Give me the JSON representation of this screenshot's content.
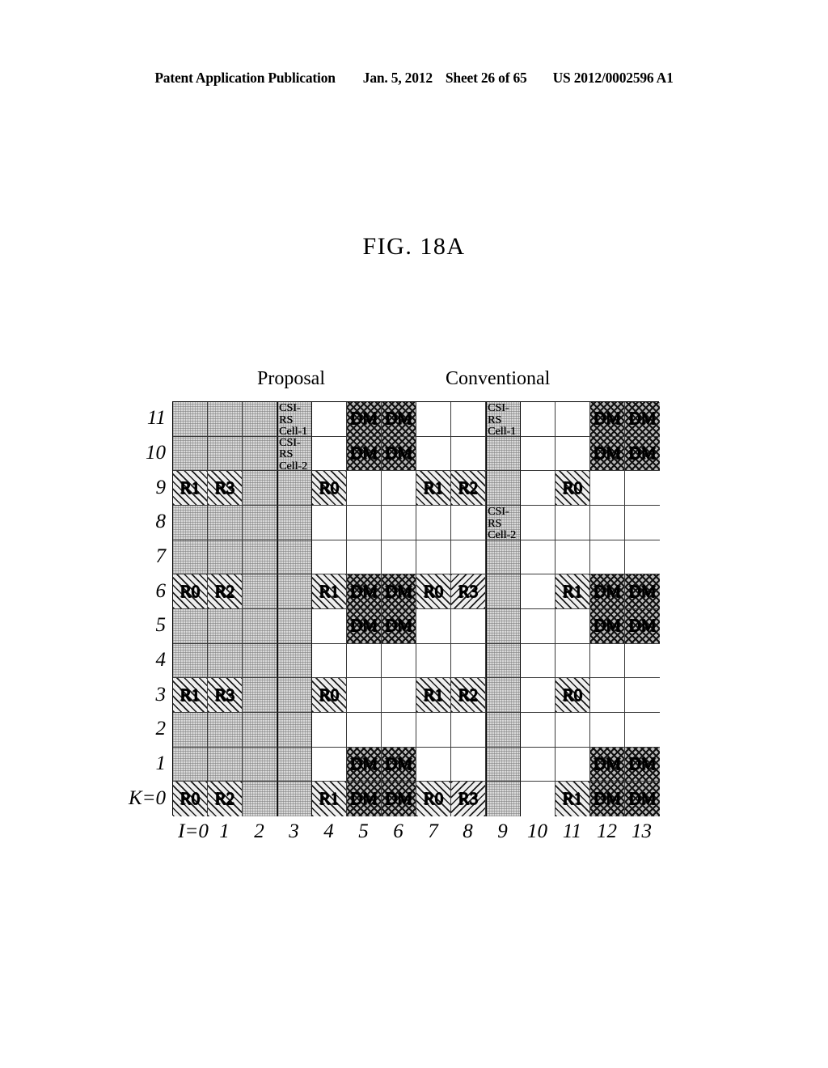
{
  "header": {
    "publication": "Patent Application Publication",
    "date": "Jan. 5, 2012",
    "sheet": "Sheet 26 of 65",
    "number": "US 2012/0002596 A1"
  },
  "figure": {
    "title": "FIG. 18A",
    "captions": {
      "left": "Proposal",
      "right": "Conventional"
    },
    "y_axis_labels": [
      "11",
      "10",
      "9",
      "8",
      "7",
      "6",
      "5",
      "4",
      "3",
      "2",
      "1",
      "K=0"
    ],
    "x_axis_labels": [
      "I=0",
      "1",
      "2",
      "3",
      "4",
      "5",
      "6",
      "7",
      "8",
      "9",
      "10",
      "11",
      "12",
      "13"
    ]
  },
  "chart_data": {
    "type": "heatmap",
    "title": "FIG. 18A",
    "xlabel": "I",
    "ylabel": "K",
    "x": [
      0,
      1,
      2,
      3,
      4,
      5,
      6,
      7,
      8,
      9,
      10,
      11,
      12,
      13
    ],
    "y": [
      11,
      10,
      9,
      8,
      7,
      6,
      5,
      4,
      3,
      2,
      1,
      0
    ],
    "legend": [
      "Proposal",
      "Conventional"
    ],
    "fill_types": {
      "white": "empty resource element",
      "gray": "light stipple shaded (reserved) column",
      "hatch": "forward diagonal hatch (CRS R-port)",
      "hatch-b": "back diagonal hatch (CRS R-port)",
      "cross": "dark cross hatch (DM-RS)"
    },
    "rows": [
      {
        "k": "11",
        "cells": [
          {
            "f": "gray",
            "t": ""
          },
          {
            "f": "gray",
            "t": ""
          },
          {
            "f": "gray",
            "t": ""
          },
          {
            "f": "gray",
            "t": "CSI-RS\nCell-1",
            "s": true
          },
          {
            "f": "white",
            "t": ""
          },
          {
            "f": "cross",
            "t": "DM"
          },
          {
            "f": "cross",
            "t": "DM"
          },
          {
            "f": "white",
            "t": ""
          },
          {
            "f": "white",
            "t": ""
          },
          {
            "f": "gray",
            "t": "CSI-RS\nCell-1",
            "s": true
          },
          {
            "f": "white",
            "t": ""
          },
          {
            "f": "white",
            "t": ""
          },
          {
            "f": "cross",
            "t": "DM"
          },
          {
            "f": "cross",
            "t": "DM"
          }
        ]
      },
      {
        "k": "10",
        "cells": [
          {
            "f": "gray",
            "t": ""
          },
          {
            "f": "gray",
            "t": ""
          },
          {
            "f": "gray",
            "t": ""
          },
          {
            "f": "gray",
            "t": "CSI-RS\nCell-2",
            "s": true
          },
          {
            "f": "white",
            "t": ""
          },
          {
            "f": "cross",
            "t": "DM"
          },
          {
            "f": "cross",
            "t": "DM"
          },
          {
            "f": "white",
            "t": ""
          },
          {
            "f": "white",
            "t": ""
          },
          {
            "f": "gray",
            "t": ""
          },
          {
            "f": "white",
            "t": ""
          },
          {
            "f": "white",
            "t": ""
          },
          {
            "f": "cross",
            "t": "DM"
          },
          {
            "f": "cross",
            "t": "DM"
          }
        ]
      },
      {
        "k": "9",
        "cells": [
          {
            "f": "hatch",
            "t": "R1"
          },
          {
            "f": "hatch",
            "t": "R3"
          },
          {
            "f": "gray",
            "t": ""
          },
          {
            "f": "gray",
            "t": ""
          },
          {
            "f": "hatch",
            "t": "R0"
          },
          {
            "f": "white",
            "t": ""
          },
          {
            "f": "white",
            "t": ""
          },
          {
            "f": "hatch",
            "t": "R1"
          },
          {
            "f": "hatch",
            "t": "R2"
          },
          {
            "f": "gray",
            "t": ""
          },
          {
            "f": "white",
            "t": ""
          },
          {
            "f": "hatch",
            "t": "R0"
          },
          {
            "f": "white",
            "t": ""
          },
          {
            "f": "white",
            "t": ""
          }
        ]
      },
      {
        "k": "8",
        "cells": [
          {
            "f": "gray",
            "t": ""
          },
          {
            "f": "gray",
            "t": ""
          },
          {
            "f": "gray",
            "t": ""
          },
          {
            "f": "gray",
            "t": ""
          },
          {
            "f": "white",
            "t": ""
          },
          {
            "f": "white",
            "t": ""
          },
          {
            "f": "white",
            "t": ""
          },
          {
            "f": "white",
            "t": ""
          },
          {
            "f": "white",
            "t": ""
          },
          {
            "f": "gray",
            "t": "CSI-RS\nCell-2",
            "s": true
          },
          {
            "f": "white",
            "t": ""
          },
          {
            "f": "white",
            "t": ""
          },
          {
            "f": "white",
            "t": ""
          },
          {
            "f": "white",
            "t": ""
          }
        ]
      },
      {
        "k": "7",
        "cells": [
          {
            "f": "gray",
            "t": ""
          },
          {
            "f": "gray",
            "t": ""
          },
          {
            "f": "gray",
            "t": ""
          },
          {
            "f": "gray",
            "t": ""
          },
          {
            "f": "white",
            "t": ""
          },
          {
            "f": "white",
            "t": ""
          },
          {
            "f": "white",
            "t": ""
          },
          {
            "f": "white",
            "t": ""
          },
          {
            "f": "white",
            "t": ""
          },
          {
            "f": "gray",
            "t": ""
          },
          {
            "f": "white",
            "t": ""
          },
          {
            "f": "white",
            "t": ""
          },
          {
            "f": "white",
            "t": ""
          },
          {
            "f": "white",
            "t": ""
          }
        ]
      },
      {
        "k": "6",
        "cells": [
          {
            "f": "hatch",
            "t": "R0"
          },
          {
            "f": "hatch",
            "t": "R2"
          },
          {
            "f": "gray",
            "t": ""
          },
          {
            "f": "gray",
            "t": ""
          },
          {
            "f": "hatch",
            "t": "R1"
          },
          {
            "f": "cross",
            "t": "DM"
          },
          {
            "f": "cross",
            "t": "DM"
          },
          {
            "f": "hatch",
            "t": "R0"
          },
          {
            "f": "hatch-b",
            "t": "R3"
          },
          {
            "f": "gray",
            "t": ""
          },
          {
            "f": "white",
            "t": ""
          },
          {
            "f": "hatch",
            "t": "R1"
          },
          {
            "f": "cross",
            "t": "DM"
          },
          {
            "f": "cross",
            "t": "DM"
          }
        ]
      },
      {
        "k": "5",
        "cells": [
          {
            "f": "gray",
            "t": ""
          },
          {
            "f": "gray",
            "t": ""
          },
          {
            "f": "gray",
            "t": ""
          },
          {
            "f": "gray",
            "t": ""
          },
          {
            "f": "white",
            "t": ""
          },
          {
            "f": "cross",
            "t": "DM"
          },
          {
            "f": "cross",
            "t": "DM"
          },
          {
            "f": "white",
            "t": ""
          },
          {
            "f": "white",
            "t": ""
          },
          {
            "f": "gray",
            "t": ""
          },
          {
            "f": "white",
            "t": ""
          },
          {
            "f": "white",
            "t": ""
          },
          {
            "f": "cross",
            "t": "DM"
          },
          {
            "f": "cross",
            "t": "DM"
          }
        ]
      },
      {
        "k": "4",
        "cells": [
          {
            "f": "gray",
            "t": ""
          },
          {
            "f": "gray",
            "t": ""
          },
          {
            "f": "gray",
            "t": ""
          },
          {
            "f": "gray",
            "t": ""
          },
          {
            "f": "white",
            "t": ""
          },
          {
            "f": "white",
            "t": ""
          },
          {
            "f": "white",
            "t": ""
          },
          {
            "f": "white",
            "t": ""
          },
          {
            "f": "white",
            "t": ""
          },
          {
            "f": "gray",
            "t": ""
          },
          {
            "f": "white",
            "t": ""
          },
          {
            "f": "white",
            "t": ""
          },
          {
            "f": "white",
            "t": ""
          },
          {
            "f": "white",
            "t": ""
          }
        ]
      },
      {
        "k": "3",
        "cells": [
          {
            "f": "hatch",
            "t": "R1"
          },
          {
            "f": "hatch",
            "t": "R3"
          },
          {
            "f": "gray",
            "t": ""
          },
          {
            "f": "gray",
            "t": ""
          },
          {
            "f": "hatch",
            "t": "R0"
          },
          {
            "f": "white",
            "t": ""
          },
          {
            "f": "white",
            "t": ""
          },
          {
            "f": "hatch",
            "t": "R1"
          },
          {
            "f": "hatch",
            "t": "R2"
          },
          {
            "f": "gray",
            "t": ""
          },
          {
            "f": "white",
            "t": ""
          },
          {
            "f": "hatch",
            "t": "R0"
          },
          {
            "f": "white",
            "t": ""
          },
          {
            "f": "white",
            "t": ""
          }
        ]
      },
      {
        "k": "2",
        "cells": [
          {
            "f": "gray",
            "t": ""
          },
          {
            "f": "gray",
            "t": ""
          },
          {
            "f": "gray",
            "t": ""
          },
          {
            "f": "gray",
            "t": ""
          },
          {
            "f": "white",
            "t": ""
          },
          {
            "f": "white",
            "t": ""
          },
          {
            "f": "white",
            "t": ""
          },
          {
            "f": "white",
            "t": ""
          },
          {
            "f": "white",
            "t": ""
          },
          {
            "f": "gray",
            "t": ""
          },
          {
            "f": "white",
            "t": ""
          },
          {
            "f": "white",
            "t": ""
          },
          {
            "f": "white",
            "t": ""
          },
          {
            "f": "white",
            "t": ""
          }
        ]
      },
      {
        "k": "1",
        "cells": [
          {
            "f": "gray",
            "t": ""
          },
          {
            "f": "gray",
            "t": ""
          },
          {
            "f": "gray",
            "t": ""
          },
          {
            "f": "gray",
            "t": ""
          },
          {
            "f": "white",
            "t": ""
          },
          {
            "f": "cross",
            "t": "DM"
          },
          {
            "f": "cross",
            "t": "DM"
          },
          {
            "f": "white",
            "t": ""
          },
          {
            "f": "white",
            "t": ""
          },
          {
            "f": "gray",
            "t": ""
          },
          {
            "f": "white",
            "t": ""
          },
          {
            "f": "white",
            "t": ""
          },
          {
            "f": "cross",
            "t": "DM"
          },
          {
            "f": "cross",
            "t": "DM"
          }
        ]
      },
      {
        "k": "K=0",
        "cells": [
          {
            "f": "hatch",
            "t": "R0"
          },
          {
            "f": "hatch",
            "t": "R2"
          },
          {
            "f": "gray",
            "t": ""
          },
          {
            "f": "gray",
            "t": ""
          },
          {
            "f": "hatch",
            "t": "R1"
          },
          {
            "f": "cross",
            "t": "DM"
          },
          {
            "f": "cross",
            "t": "DM"
          },
          {
            "f": "hatch",
            "t": "R0"
          },
          {
            "f": "hatch-b",
            "t": "R3"
          },
          {
            "f": "gray",
            "t": ""
          },
          {
            "f": "white",
            "t": ""
          },
          {
            "f": "hatch",
            "t": "R1"
          },
          {
            "f": "cross",
            "t": "DM"
          },
          {
            "f": "cross",
            "t": "DM"
          }
        ]
      }
    ]
  }
}
